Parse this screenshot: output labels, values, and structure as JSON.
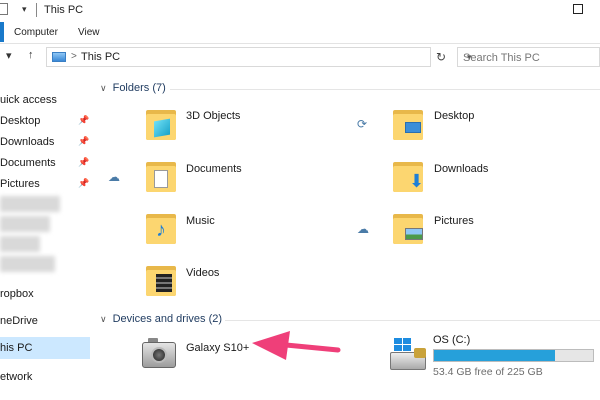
{
  "window": {
    "title": "This PC"
  },
  "ribbon": {
    "tabs": [
      "Computer",
      "View"
    ]
  },
  "address": {
    "path": "This PC",
    "chevron": ">",
    "search_placeholder": "Search This PC"
  },
  "nav": {
    "items": [
      {
        "label": "uick access",
        "pinned": false
      },
      {
        "label": "Desktop",
        "pinned": true
      },
      {
        "label": "Downloads",
        "pinned": true
      },
      {
        "label": "Documents",
        "pinned": true
      },
      {
        "label": "Pictures",
        "pinned": true
      },
      {
        "label": "ropbox",
        "pinned": false
      },
      {
        "label": "neDrive",
        "pinned": false
      },
      {
        "label": "his PC",
        "selected": true
      },
      {
        "label": "etwork",
        "pinned": false
      }
    ],
    "pin_glyph": "★"
  },
  "folders": {
    "header": "Folders (7)",
    "items": [
      {
        "label": "3D Objects",
        "badge": "cube-icon"
      },
      {
        "label": "Desktop",
        "badge": "desktop-icon",
        "status": "sync-icon"
      },
      {
        "label": "Documents",
        "badge": "document-icon",
        "status": "cloud-icon"
      },
      {
        "label": "Downloads",
        "badge": "download-arrow-icon"
      },
      {
        "label": "Music",
        "badge": "music-note-icon"
      },
      {
        "label": "Pictures",
        "badge": "landscape-icon",
        "status": "cloud-icon"
      },
      {
        "label": "Videos",
        "badge": "film-icon"
      }
    ]
  },
  "devices": {
    "header": "Devices and drives (2)",
    "items": [
      {
        "label": "Galaxy S10+",
        "icon": "camera-icon"
      },
      {
        "label": "OS (C:)",
        "icon": "drive-icon",
        "used_fraction": 0.763,
        "free_text": "53.4 GB free of 225 GB"
      }
    ]
  },
  "colors": {
    "accent": "#1979ca",
    "bar": "#26a0da",
    "folder": "#fcd670",
    "arrow": "#ef3f79"
  }
}
